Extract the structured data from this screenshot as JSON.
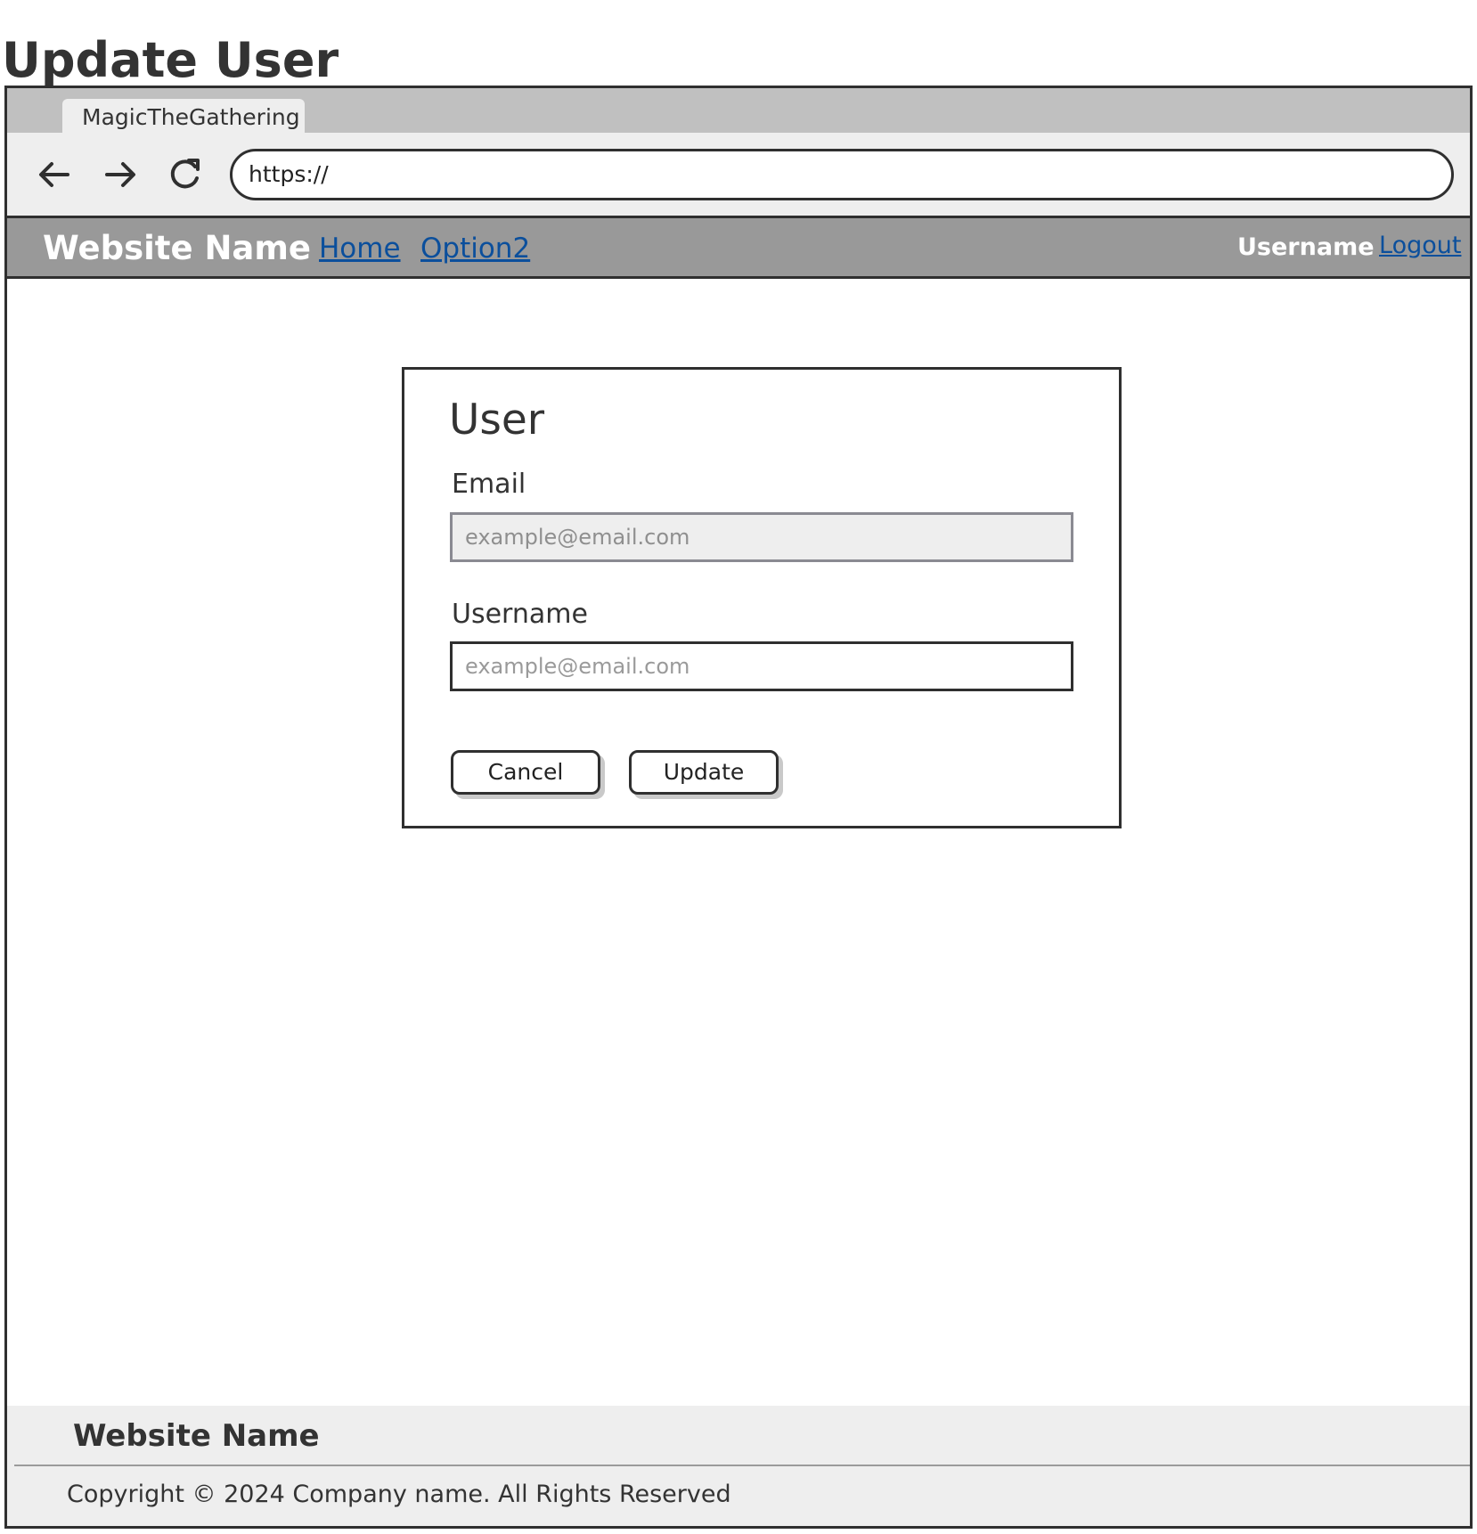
{
  "page": {
    "title": "Update User"
  },
  "browser": {
    "tab_title": "MagicTheGathering",
    "url": "https://",
    "back_icon": "arrow-left-icon",
    "forward_icon": "arrow-right-icon",
    "reload_icon": "reload-icon"
  },
  "nav": {
    "brand": "Website Name",
    "links": [
      {
        "label": "Home"
      },
      {
        "label": "Option2"
      }
    ],
    "username": "Username",
    "logout_label": "Logout",
    "link_color": "#0b4f9c",
    "background_color": "#999999"
  },
  "form": {
    "title": "User",
    "email": {
      "label": "Email",
      "placeholder": "example@email.com",
      "value": ""
    },
    "username": {
      "label": "Username",
      "placeholder": "example@email.com",
      "value": ""
    },
    "cancel_label": "Cancel",
    "update_label": "Update"
  },
  "footer": {
    "brand": "Website Name",
    "copyright": "Copyright © 2024 Company name. All Rights Reserved",
    "background_color": "#eeeeee"
  }
}
